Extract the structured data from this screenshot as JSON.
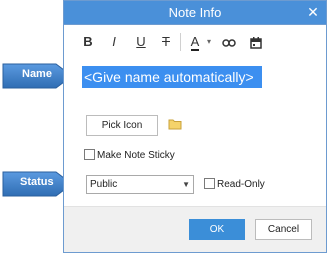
{
  "window": {
    "title": "Note Info",
    "close_glyph": "✕"
  },
  "toolbar": {
    "bold": "B",
    "italic": "I",
    "underline": "U",
    "strike": "T",
    "font_color": "A",
    "dropdown": "▾",
    "items": [
      {
        "icon": "bold-icon"
      },
      {
        "icon": "italic-icon"
      },
      {
        "icon": "underline-icon"
      },
      {
        "icon": "strikethrough-icon"
      },
      {
        "icon": "font-color-icon"
      },
      {
        "icon": "link-icon"
      },
      {
        "icon": "calendar-icon"
      }
    ]
  },
  "name": {
    "value": "<Give name automatically>"
  },
  "icon_picker": {
    "button_label": "Pick Icon",
    "icon": "folder-icon"
  },
  "sticky": {
    "label": "Make Note Sticky",
    "checked": false
  },
  "status": {
    "value": "Public"
  },
  "readonly": {
    "label": "Read-Only",
    "checked": false
  },
  "footer": {
    "ok_label": "OK",
    "cancel_label": "Cancel"
  },
  "callouts": {
    "name": "Name",
    "status": "Status"
  },
  "colors": {
    "title_bar": "#4a90d9",
    "accent": "#3c8ff0",
    "callout": "#3a7cc4"
  }
}
